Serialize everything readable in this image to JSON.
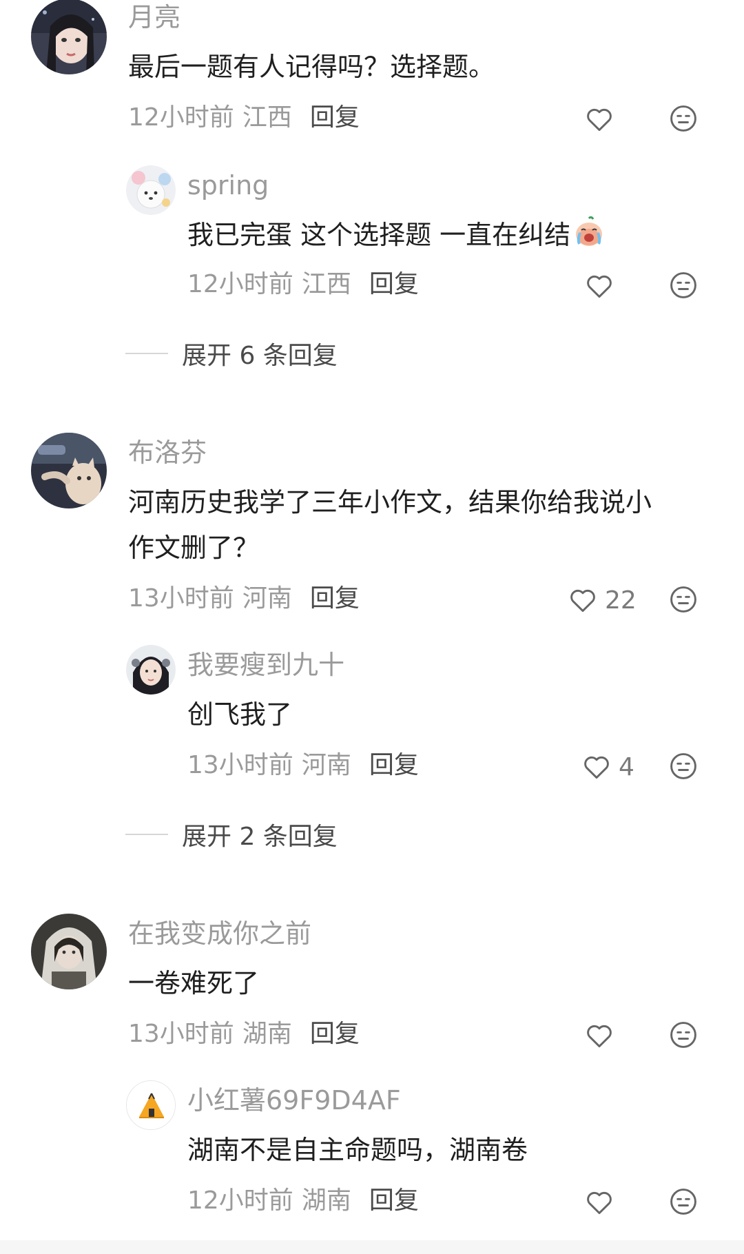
{
  "comments": [
    {
      "author": "月亮",
      "text": "最后一题有人记得吗？选择题。",
      "time": "12小时前",
      "location": "江西",
      "reply_label": "回复",
      "likes": "",
      "replies": [
        {
          "author": "spring",
          "text": "我已完蛋 这个选择题 一直在纠结",
          "emoji": "crying-face-emoji",
          "time": "12小时前",
          "location": "江西",
          "reply_label": "回复",
          "likes": ""
        }
      ],
      "expand_label": "展开 6 条回复"
    },
    {
      "author": "布洛芬",
      "text_line1": "河南历史我学了三年小作文，结果你给我说小",
      "text_line2": "作文删了？",
      "time": "13小时前",
      "location": "河南",
      "reply_label": "回复",
      "likes": "22",
      "replies": [
        {
          "author": "我要瘦到九十",
          "text": "创飞我了",
          "time": "13小时前",
          "location": "河南",
          "reply_label": "回复",
          "likes": "4"
        }
      ],
      "expand_label": "展开 2 条回复"
    },
    {
      "author": "在我变成你之前",
      "text": "一卷难死了",
      "time": "13小时前",
      "location": "湖南",
      "reply_label": "回复",
      "likes": "",
      "replies": [
        {
          "author": "小红薯69F9D4AF",
          "text": "湖南不是自主命题吗，湖南卷",
          "time": "12小时前",
          "location": "湖南",
          "reply_label": "回复",
          "likes": ""
        }
      ]
    }
  ],
  "icons": {
    "like": "heart-outline-icon",
    "dislike": "neutral-face-icon"
  },
  "colors": {
    "secondary_text": "#9a9a9a",
    "primary_text": "#1f1f1f",
    "reply_text": "#4a4a4a"
  }
}
